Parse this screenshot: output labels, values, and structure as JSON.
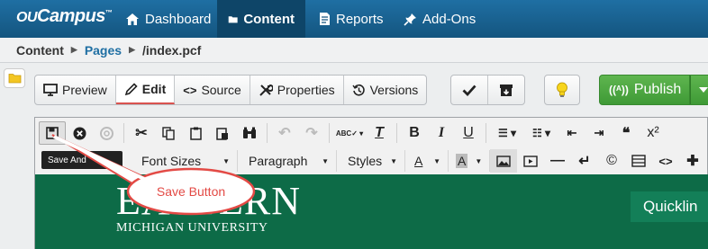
{
  "brand": {
    "logo_prefix": "OU",
    "logo_main": "Campus",
    "logo_tm": "™"
  },
  "nav": [
    {
      "label": "Dashboard",
      "icon": "home-icon"
    },
    {
      "label": "Content",
      "icon": "folder-icon",
      "active": true
    },
    {
      "label": "Reports",
      "icon": "document-icon"
    },
    {
      "label": "Add-Ons",
      "icon": "pin-icon"
    }
  ],
  "breadcrumb": {
    "root": "Content",
    "section": "Pages",
    "file": "/index.pcf"
  },
  "actions": {
    "preview": "Preview",
    "edit": "Edit",
    "source": "Source",
    "properties": "Properties",
    "versions": "Versions",
    "publish": "Publish"
  },
  "toolbar": {
    "save_tooltip": "Save And",
    "font_sizes": "Font Sizes",
    "paragraph": "Paragraph",
    "styles": "Styles",
    "text_color": "A",
    "bg_color": "A",
    "quote": "❝",
    "superscript": "x²"
  },
  "preview": {
    "logo_big": "EASTERN",
    "logo_sub": "MICHIGAN UNIVERSITY",
    "quicklinks": "Quicklin"
  },
  "callout": {
    "label": "Save Button"
  },
  "colors": {
    "nav_bg": "#1f6fa3",
    "nav_active": "#0e4568",
    "publish": "#3f9a36",
    "preview_bg": "#0d6b47",
    "callout": "#e34a45"
  }
}
